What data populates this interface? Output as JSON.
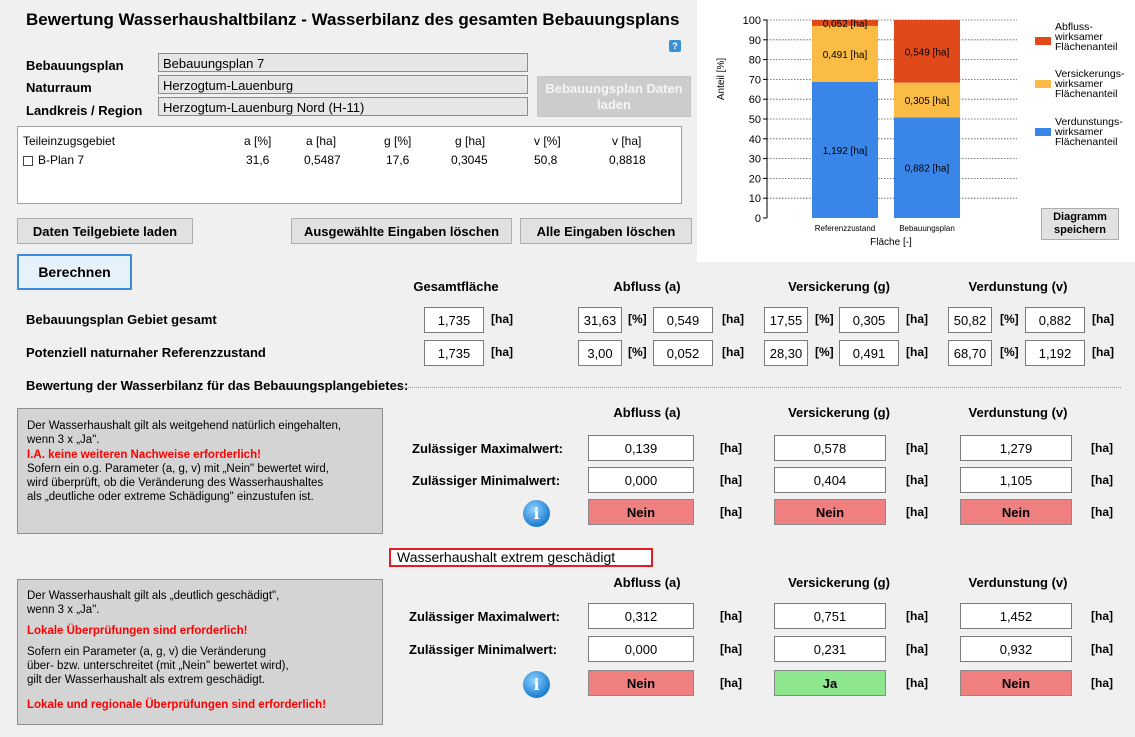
{
  "app": {
    "title": "Bewertung Wasserhaushaltbilanz - Wasserbilanz des gesamten Bebauungsplans",
    "help_glyph": "?"
  },
  "plan_info": {
    "labels": {
      "bebauungsplan": "Bebauungsplan",
      "naturraum": "Naturraum",
      "landkreis": "Landkreis / Region"
    },
    "values": {
      "bebauungsplan": "Bebauungsplan 7",
      "naturraum": "Herzogtum-Lauenburg",
      "landkreis": "Herzogtum-Lauenburg Nord (H-11)"
    },
    "load_button": "Bebauungsplan Daten laden"
  },
  "teilgebiete_table": {
    "columns": [
      "Teileinzugsgebiet",
      "a [%]",
      "a [ha]",
      "g [%]",
      "g [ha]",
      "v [%]",
      "v [ha]"
    ],
    "rows": [
      {
        "name": "B-Plan 7",
        "checked": false,
        "values": [
          "31,6",
          "0,5487",
          "17,6",
          "0,3045",
          "50,8",
          "0,8818"
        ]
      }
    ]
  },
  "buttons": {
    "load_subareas": "Daten Teilgebiete laden",
    "clear_selected": "Ausgewählte Eingaben löschen",
    "clear_all": "Alle Eingaben löschen",
    "calculate": "Berechnen",
    "save_chart": "Diagramm speichern"
  },
  "summary": {
    "headers": {
      "total": "Gesamtfläche",
      "abfluss": "Abfluss (a)",
      "versickerung": "Versickerung (g)",
      "verdunstung": "Verdunstung (v)"
    },
    "units": {
      "ha": "[ha]",
      "pct": "[%]"
    },
    "rows": [
      {
        "label": "Bebauungsplan Gebiet gesamt",
        "total": "1,735",
        "a_pct": "31,63",
        "a_ha": "0,549",
        "g_pct": "17,55",
        "g_ha": "0,305",
        "v_pct": "50,82",
        "v_ha": "0,882"
      },
      {
        "label": "Potenziell naturnaher Referenzzustand",
        "total": "1,735",
        "a_pct": "3,00",
        "a_ha": "0,052",
        "g_pct": "28,30",
        "g_ha": "0,491",
        "v_pct": "68,70",
        "v_ha": "1,192"
      }
    ]
  },
  "evaluation": {
    "section_title": "Bewertung der Wasserbilanz für das Bebauungsplangebietes:",
    "block1": {
      "info_lines": [
        {
          "text": "Der Wasserhaushalt gilt als weitgehend natürlich eingehalten,",
          "red": false
        },
        {
          "text": "wenn 3 x „Ja\".",
          "red": false
        },
        {
          "text": "I.A. keine weiteren Nachweise erforderlich!",
          "red": true
        },
        {
          "text": "Sofern ein o.g. Parameter (a, g, v) mit „Nein\" bewertet wird,",
          "red": false
        },
        {
          "text": "wird überprüft, ob die Veränderung des Wasserhaushaltes",
          "red": false
        },
        {
          "text": "als „deutliche oder extreme Schädigung\" einzustufen ist.",
          "red": false
        }
      ],
      "headers": {
        "abfluss": "Abfluss (a)",
        "versickerung": "Versickerung (g)",
        "verdunstung": "Verdunstung (v)"
      },
      "max_label": "Zulässiger Maximalwert:",
      "min_label": "Zulässiger Minimalwert:",
      "max": {
        "a": "0,139",
        "g": "0,578",
        "v": "1,279"
      },
      "min": {
        "a": "0,000",
        "g": "0,404",
        "v": "1,105"
      },
      "status": {
        "a": "Nein",
        "g": "Nein",
        "v": "Nein"
      }
    },
    "verdict": "Wasserhaushalt extrem geschädigt",
    "block2": {
      "info_lines": [
        {
          "text": "Der Wasserhaushalt gilt als „deutlich geschädigt\",",
          "red": false
        },
        {
          "text": "wenn 3 x „Ja\".",
          "red": false
        },
        {
          "text": "Lokale Überprüfungen sind erforderlich!",
          "red": true
        },
        {
          "text": "Sofern ein Parameter (a, g, v) die Veränderung",
          "red": false
        },
        {
          "text": "über- bzw. unterschreitet (mit „Nein\" bewertet wird),",
          "red": false
        },
        {
          "text": "gilt der Wasserhaushalt als extrem geschädigt.",
          "red": false
        },
        {
          "text": "Lokale und regionale Überprüfungen sind erforderlich!",
          "red": true
        }
      ],
      "headers": {
        "abfluss": "Abfluss (a)",
        "versickerung": "Versickerung (g)",
        "verdunstung": "Verdunstung (v)"
      },
      "max_label": "Zulässiger Maximalwert:",
      "min_label": "Zulässiger Minimalwert:",
      "max": {
        "a": "0,312",
        "g": "0,751",
        "v": "1,452"
      },
      "min": {
        "a": "0,000",
        "g": "0,231",
        "v": "0,932"
      },
      "status": {
        "a": "Nein",
        "g": "Ja",
        "v": "Nein"
      }
    },
    "info_glyph": "i"
  },
  "colors": {
    "abfluss": "#e04a1b",
    "versickerung": "#fbbc45",
    "verdunstung": "#3a86e8",
    "status_nein": "#f07f7f",
    "status_ja": "#8ee68e",
    "verdict_border": "#e51c23"
  },
  "chart_data": {
    "type": "bar",
    "stacked": true,
    "categories": [
      "Referenzzustand",
      "Bebauungsplan"
    ],
    "xlabel": "Fläche [-]",
    "ylabel": "Anteil [%]",
    "ylim": [
      0,
      100
    ],
    "yticks": [
      0,
      10,
      20,
      30,
      40,
      50,
      60,
      70,
      80,
      90,
      100
    ],
    "grid": true,
    "legend_position": "right",
    "series": [
      {
        "name": "Verdunstungs-\nwirksamer\nFlächenanteil",
        "color": "#3a86e8",
        "values": [
          68.7,
          50.82
        ],
        "labels": [
          "1,192 [ha]",
          "0,882 [ha]"
        ]
      },
      {
        "name": "Versickerungs-\nwirksamer\nFlächenanteil",
        "color": "#fbbc45",
        "values": [
          28.3,
          17.55
        ],
        "labels": [
          "0,491 [ha]",
          "0,305 [ha]"
        ]
      },
      {
        "name": "Abfluss-\nwirksamer\nFlächenanteil",
        "color": "#e04a1b",
        "values": [
          3.0,
          31.63
        ],
        "labels": [
          "0,052 [ha]",
          "0,549 [ha]"
        ]
      }
    ]
  }
}
